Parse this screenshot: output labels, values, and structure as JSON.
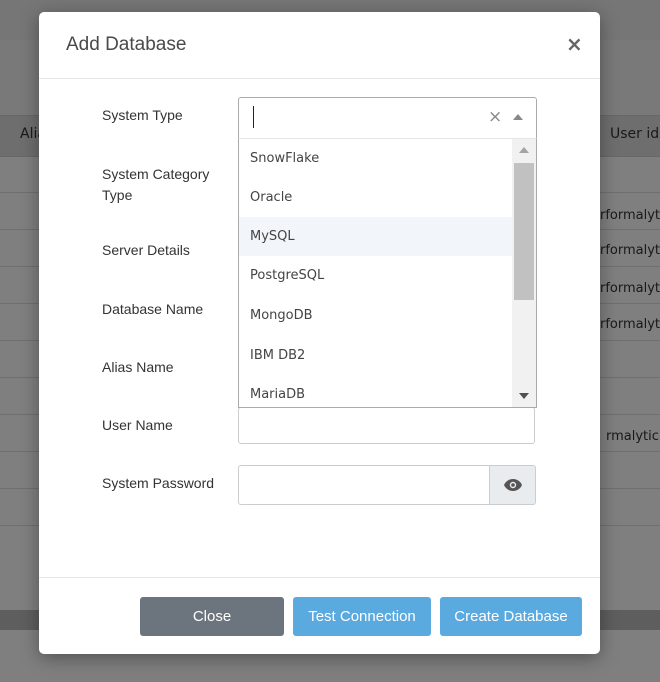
{
  "background": {
    "table_header_left": "Alia",
    "table_header_right": "User id ⇕",
    "row_values": [
      "",
      "rformalytic",
      "rformalytic",
      "rformalytic",
      "rformalytic",
      "",
      "",
      "rmalytic.c",
      "",
      ""
    ]
  },
  "modal": {
    "title": "Add Database",
    "close_glyph": "×",
    "labels": {
      "system_type": "System Type",
      "system_category_type": "System Category Type",
      "server_details": "Server Details",
      "database_name": "Database Name",
      "alias_name": "Alias Name",
      "user_name": "User Name",
      "system_password": "System Password"
    },
    "system_type_select": {
      "value": "",
      "clear_glyph": "×",
      "options": [
        "SnowFlake",
        "Oracle",
        "MySQL",
        "PostgreSQL",
        "MongoDB",
        "IBM DB2",
        "MariaDB"
      ],
      "highlighted": "MySQL"
    },
    "user_name": {
      "value": ""
    },
    "system_password": {
      "value": ""
    },
    "buttons": {
      "close": "Close",
      "test_connection": "Test Connection",
      "create_database": "Create Database"
    }
  },
  "colors": {
    "overlay": "#000000",
    "primary_button": "#5aaae0",
    "secondary_button": "#6c757d",
    "option_highlight": "#f2f5f9"
  }
}
